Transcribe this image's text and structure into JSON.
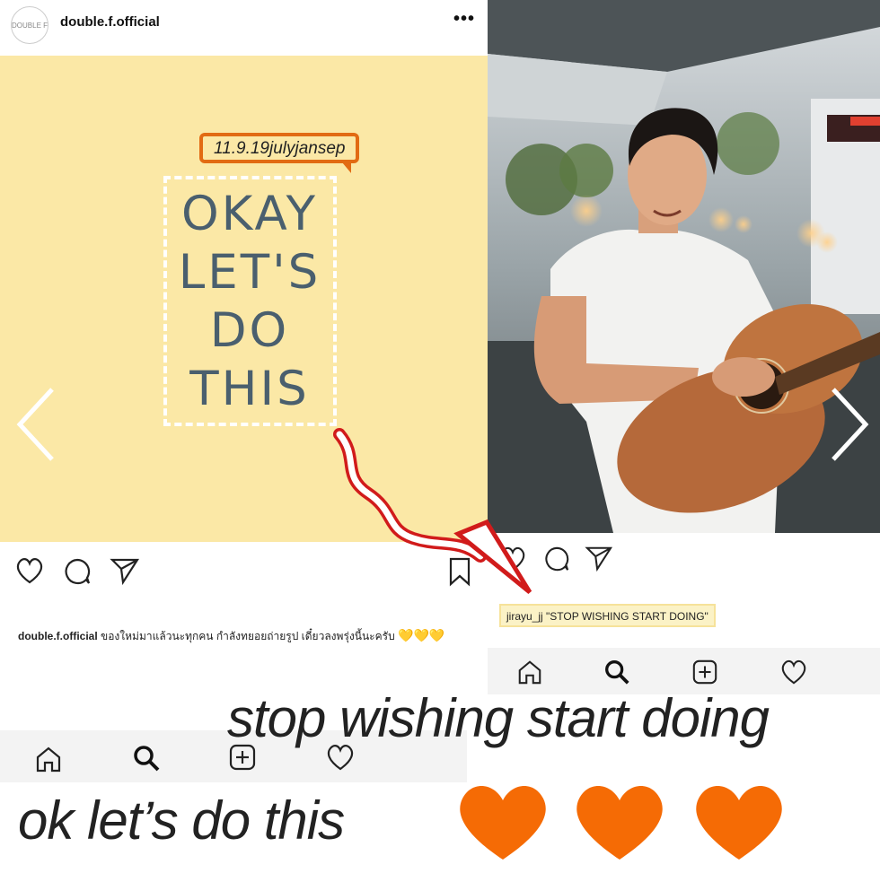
{
  "left_post": {
    "username": "double.f.official",
    "avatar_text": "DOUBLE F",
    "more": "•••",
    "date_tag": "11.9.19julyjansep",
    "image_text": "OKAY LET'S DO THIS",
    "caption_user": "double.f.official",
    "caption_text": "ของใหม่มาแล้วนะทุกคน กำลังทยอยถ่ายรูป เดี๋ยวลงพรุ่งนี้นะครับ",
    "caption_emoji": "💛💛💛"
  },
  "right_post": {
    "caption": "jirayu_jj \"STOP WISHING START DOING\""
  },
  "overlay": {
    "stop_text": "stop wishing start doing",
    "ok_text": "ok let’s do this"
  },
  "colors": {
    "post_bg": "#fbe8a6",
    "tag_border": "#e26b13",
    "arrow": "#d11b1b",
    "hearts": "#f56b05",
    "text_dark": "#4a5f6e"
  },
  "icons": [
    "heart-icon",
    "comment-icon",
    "share-icon",
    "bookmark-icon",
    "home-icon",
    "search-icon",
    "add-post-icon",
    "activity-heart-icon",
    "chevron-left-icon",
    "chevron-right-icon",
    "more-icon"
  ]
}
